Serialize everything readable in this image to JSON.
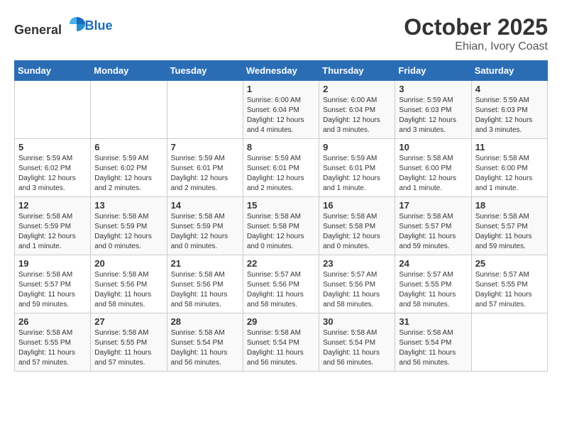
{
  "logo": {
    "text_general": "General",
    "text_blue": "Blue"
  },
  "header": {
    "month": "October 2025",
    "location": "Ehian, Ivory Coast"
  },
  "weekdays": [
    "Sunday",
    "Monday",
    "Tuesday",
    "Wednesday",
    "Thursday",
    "Friday",
    "Saturday"
  ],
  "weeks": [
    [
      {
        "day": "",
        "info": ""
      },
      {
        "day": "",
        "info": ""
      },
      {
        "day": "",
        "info": ""
      },
      {
        "day": "1",
        "info": "Sunrise: 6:00 AM\nSunset: 6:04 PM\nDaylight: 12 hours\nand 4 minutes."
      },
      {
        "day": "2",
        "info": "Sunrise: 6:00 AM\nSunset: 6:04 PM\nDaylight: 12 hours\nand 3 minutes."
      },
      {
        "day": "3",
        "info": "Sunrise: 5:59 AM\nSunset: 6:03 PM\nDaylight: 12 hours\nand 3 minutes."
      },
      {
        "day": "4",
        "info": "Sunrise: 5:59 AM\nSunset: 6:03 PM\nDaylight: 12 hours\nand 3 minutes."
      }
    ],
    [
      {
        "day": "5",
        "info": "Sunrise: 5:59 AM\nSunset: 6:02 PM\nDaylight: 12 hours\nand 3 minutes."
      },
      {
        "day": "6",
        "info": "Sunrise: 5:59 AM\nSunset: 6:02 PM\nDaylight: 12 hours\nand 2 minutes."
      },
      {
        "day": "7",
        "info": "Sunrise: 5:59 AM\nSunset: 6:01 PM\nDaylight: 12 hours\nand 2 minutes."
      },
      {
        "day": "8",
        "info": "Sunrise: 5:59 AM\nSunset: 6:01 PM\nDaylight: 12 hours\nand 2 minutes."
      },
      {
        "day": "9",
        "info": "Sunrise: 5:59 AM\nSunset: 6:01 PM\nDaylight: 12 hours\nand 1 minute."
      },
      {
        "day": "10",
        "info": "Sunrise: 5:58 AM\nSunset: 6:00 PM\nDaylight: 12 hours\nand 1 minute."
      },
      {
        "day": "11",
        "info": "Sunrise: 5:58 AM\nSunset: 6:00 PM\nDaylight: 12 hours\nand 1 minute."
      }
    ],
    [
      {
        "day": "12",
        "info": "Sunrise: 5:58 AM\nSunset: 5:59 PM\nDaylight: 12 hours\nand 1 minute."
      },
      {
        "day": "13",
        "info": "Sunrise: 5:58 AM\nSunset: 5:59 PM\nDaylight: 12 hours\nand 0 minutes."
      },
      {
        "day": "14",
        "info": "Sunrise: 5:58 AM\nSunset: 5:59 PM\nDaylight: 12 hours\nand 0 minutes."
      },
      {
        "day": "15",
        "info": "Sunrise: 5:58 AM\nSunset: 5:58 PM\nDaylight: 12 hours\nand 0 minutes."
      },
      {
        "day": "16",
        "info": "Sunrise: 5:58 AM\nSunset: 5:58 PM\nDaylight: 12 hours\nand 0 minutes."
      },
      {
        "day": "17",
        "info": "Sunrise: 5:58 AM\nSunset: 5:57 PM\nDaylight: 11 hours\nand 59 minutes."
      },
      {
        "day": "18",
        "info": "Sunrise: 5:58 AM\nSunset: 5:57 PM\nDaylight: 11 hours\nand 59 minutes."
      }
    ],
    [
      {
        "day": "19",
        "info": "Sunrise: 5:58 AM\nSunset: 5:57 PM\nDaylight: 11 hours\nand 59 minutes."
      },
      {
        "day": "20",
        "info": "Sunrise: 5:58 AM\nSunset: 5:56 PM\nDaylight: 11 hours\nand 58 minutes."
      },
      {
        "day": "21",
        "info": "Sunrise: 5:58 AM\nSunset: 5:56 PM\nDaylight: 11 hours\nand 58 minutes."
      },
      {
        "day": "22",
        "info": "Sunrise: 5:57 AM\nSunset: 5:56 PM\nDaylight: 11 hours\nand 58 minutes."
      },
      {
        "day": "23",
        "info": "Sunrise: 5:57 AM\nSunset: 5:56 PM\nDaylight: 11 hours\nand 58 minutes."
      },
      {
        "day": "24",
        "info": "Sunrise: 5:57 AM\nSunset: 5:55 PM\nDaylight: 11 hours\nand 58 minutes."
      },
      {
        "day": "25",
        "info": "Sunrise: 5:57 AM\nSunset: 5:55 PM\nDaylight: 11 hours\nand 57 minutes."
      }
    ],
    [
      {
        "day": "26",
        "info": "Sunrise: 5:58 AM\nSunset: 5:55 PM\nDaylight: 11 hours\nand 57 minutes."
      },
      {
        "day": "27",
        "info": "Sunrise: 5:58 AM\nSunset: 5:55 PM\nDaylight: 11 hours\nand 57 minutes."
      },
      {
        "day": "28",
        "info": "Sunrise: 5:58 AM\nSunset: 5:54 PM\nDaylight: 11 hours\nand 56 minutes."
      },
      {
        "day": "29",
        "info": "Sunrise: 5:58 AM\nSunset: 5:54 PM\nDaylight: 11 hours\nand 56 minutes."
      },
      {
        "day": "30",
        "info": "Sunrise: 5:58 AM\nSunset: 5:54 PM\nDaylight: 11 hours\nand 56 minutes."
      },
      {
        "day": "31",
        "info": "Sunrise: 5:58 AM\nSunset: 5:54 PM\nDaylight: 11 hours\nand 56 minutes."
      },
      {
        "day": "",
        "info": ""
      }
    ]
  ]
}
